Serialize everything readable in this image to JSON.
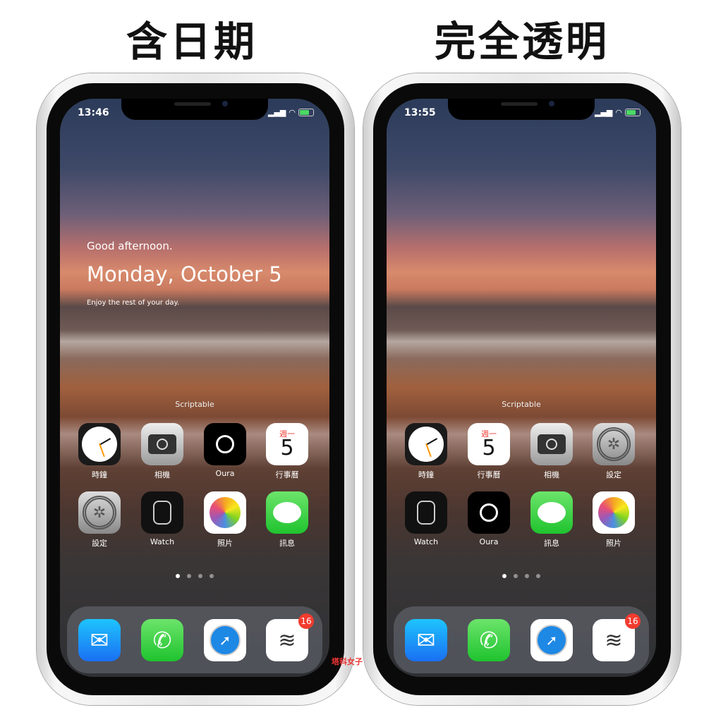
{
  "titles": [
    "含日期",
    "完全透明"
  ],
  "phones": [
    {
      "time": "13:46",
      "widget": {
        "greeting": "Good afternoon.",
        "date": "Monday, October 5",
        "message": "Enjoy the rest of your day."
      },
      "widget_label": "Scriptable",
      "apps": [
        {
          "label": "時鐘",
          "icon": "clock-icon"
        },
        {
          "label": "相機",
          "icon": "camera-icon"
        },
        {
          "label": "Oura",
          "icon": "oura-icon"
        },
        {
          "label": "行事曆",
          "icon": "calendar-icon"
        },
        {
          "label": "設定",
          "icon": "settings-icon"
        },
        {
          "label": "Watch",
          "icon": "watch-icon"
        },
        {
          "label": "照片",
          "icon": "photos-icon"
        },
        {
          "label": "訊息",
          "icon": "messages-icon"
        }
      ],
      "dock": [
        {
          "icon": "mail-icon"
        },
        {
          "icon": "phone-icon"
        },
        {
          "icon": "safari-icon"
        },
        {
          "icon": "todoist-icon",
          "badge": "16"
        }
      ]
    },
    {
      "time": "13:55",
      "widget": {
        "greeting": "",
        "date": "",
        "message": ""
      },
      "widget_label": "Scriptable",
      "apps": [
        {
          "label": "時鐘",
          "icon": "clock-icon"
        },
        {
          "label": "行事曆",
          "icon": "calendar-icon"
        },
        {
          "label": "相機",
          "icon": "camera-icon"
        },
        {
          "label": "設定",
          "icon": "settings-icon"
        },
        {
          "label": "Watch",
          "icon": "watch-icon"
        },
        {
          "label": "Oura",
          "icon": "oura-icon"
        },
        {
          "label": "訊息",
          "icon": "messages-icon"
        },
        {
          "label": "照片",
          "icon": "photos-icon"
        }
      ],
      "dock": [
        {
          "icon": "mail-icon"
        },
        {
          "icon": "phone-icon"
        },
        {
          "icon": "safari-icon"
        },
        {
          "icon": "todoist-icon",
          "badge": "16"
        }
      ]
    }
  ],
  "calendar": {
    "weekday": "週一",
    "day": "5"
  },
  "page_dots": {
    "count": 4,
    "active": 0
  },
  "watermark": "塔科女子"
}
